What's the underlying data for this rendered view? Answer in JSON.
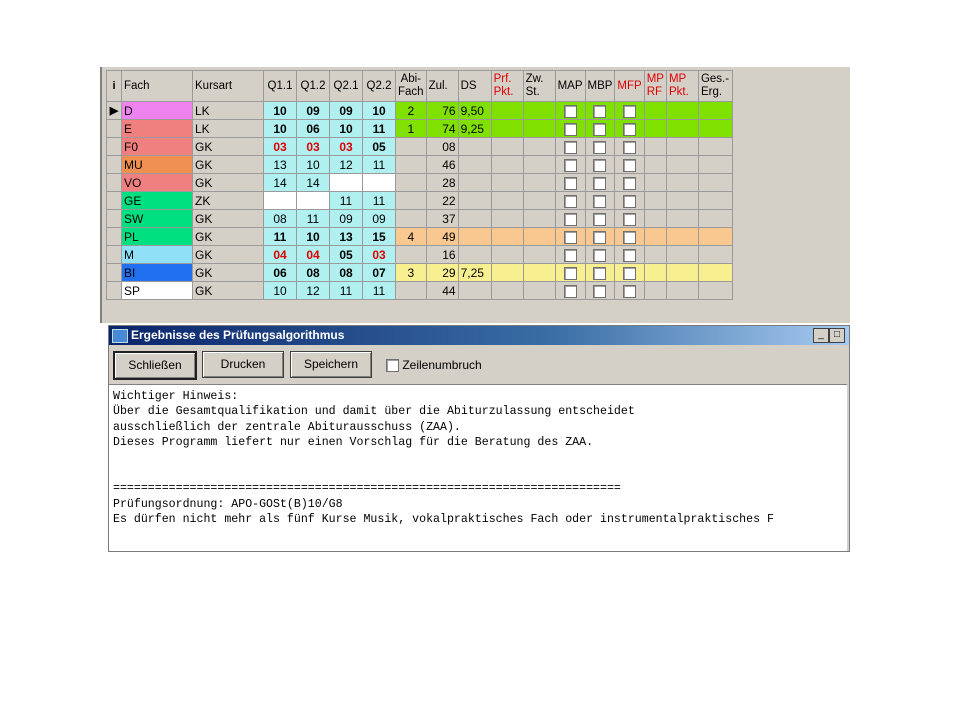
{
  "grid": {
    "headers": {
      "i": "i",
      "fach": "Fach",
      "kursart": "Kursart",
      "q11": "Q1.1",
      "q12": "Q1.2",
      "q21": "Q2.1",
      "q22": "Q2.2",
      "abi_1": "Abi-",
      "abi_2": "Fach",
      "zul": "Zul.",
      "ds": "DS",
      "prf_1": "Prf.",
      "prf_2": "Pkt.",
      "zw_1": "Zw.",
      "zw_2": "St.",
      "map": "MAP",
      "mbp": "MBP",
      "mfp": "MFP",
      "mprf_1": "MP",
      "mprf_2": "RF",
      "mppkt_1": "MP",
      "mppkt_2": "Pkt.",
      "ges_1": "Ges.-",
      "ges_2": "Erg."
    },
    "rows": [
      {
        "fach": "D",
        "kurs": "LK",
        "q": [
          "10",
          "09",
          "09",
          "10"
        ],
        "abi": "2",
        "zul": "76",
        "ds": "9,50",
        "fach_color": "#ee82ee",
        "row_color": "#80e000",
        "qbg": "#b0f0f0"
      },
      {
        "fach": "E",
        "kurs": "LK",
        "q": [
          "10",
          "06",
          "10",
          "11"
        ],
        "abi": "1",
        "zul": "74",
        "ds": "9,25",
        "fach_color": "#f08080",
        "row_color": "#80e000",
        "qbg": "#b0f0f0"
      },
      {
        "fach": "F0",
        "kurs": "GK",
        "q": [
          "03",
          "03",
          "03",
          "05"
        ],
        "abi": "",
        "zul": "08",
        "ds": "",
        "fach_color": "#f08080",
        "row_color": "",
        "qbg": "#b0f0f0"
      },
      {
        "fach": "MU",
        "kurs": "GK",
        "q": [
          "13",
          "10",
          "12",
          "11"
        ],
        "abi": "",
        "zul": "46",
        "ds": "",
        "fach_color": "#f09050",
        "row_color": "",
        "qbg": "#b0f0f0"
      },
      {
        "fach": "VO",
        "kurs": "GK",
        "q": [
          "14",
          "14",
          "",
          ""
        ],
        "abi": "",
        "zul": "28",
        "ds": "",
        "fach_color": "#f08080",
        "row_color": "",
        "qbg": "#b0f0f0"
      },
      {
        "fach": "GE",
        "kurs": "ZK",
        "q": [
          "",
          "",
          "11",
          "11"
        ],
        "abi": "",
        "zul": "22",
        "ds": "",
        "fach_color": "#00e080",
        "row_color": "",
        "qbg": "#b0f0f0"
      },
      {
        "fach": "SW",
        "kurs": "GK",
        "q": [
          "08",
          "11",
          "09",
          "09"
        ],
        "abi": "",
        "zul": "37",
        "ds": "",
        "fach_color": "#00e080",
        "row_color": "",
        "qbg": "#b0f0f0"
      },
      {
        "fach": "PL",
        "kurs": "GK",
        "q": [
          "11",
          "10",
          "13",
          "15"
        ],
        "abi": "4",
        "zul": "49",
        "ds": "",
        "fach_color": "#00e080",
        "row_color": "#f8c890",
        "qbg": "#b0f0f0"
      },
      {
        "fach": "M",
        "kurs": "GK",
        "q": [
          "04",
          "04",
          "05",
          "03"
        ],
        "abi": "",
        "zul": "16",
        "ds": "",
        "fach_color": "#90e0f8",
        "row_color": "",
        "qbg": "#b0f0f0"
      },
      {
        "fach": "BI",
        "kurs": "GK",
        "q": [
          "06",
          "08",
          "08",
          "07"
        ],
        "abi": "3",
        "zul": "29",
        "ds": "7,25",
        "fach_color": "#2070f0",
        "row_color": "#f8f090",
        "qbg": "#b0f0f0"
      },
      {
        "fach": "SP",
        "kurs": "GK",
        "q": [
          "10",
          "12",
          "11",
          "11"
        ],
        "abi": "",
        "zul": "44",
        "ds": "",
        "fach_color": "#ffffff",
        "row_color": "",
        "qbg": "#b0f0f0"
      }
    ],
    "bold_rows": [
      0,
      1,
      2,
      7,
      8,
      9
    ],
    "red_cells": [
      [
        2,
        0
      ],
      [
        2,
        1
      ],
      [
        2,
        2
      ],
      [
        8,
        0
      ],
      [
        8,
        1
      ],
      [
        8,
        3
      ]
    ],
    "current_row_marker": "▶"
  },
  "window": {
    "title": "Ergebnisse des Prüfungsalgorithmus",
    "minimize": "_",
    "maximize": "□",
    "buttons": {
      "close": "Schließen",
      "print": "Drucken",
      "save": "Speichern"
    },
    "checkbox_label": "Zeilenumbruch",
    "text": "Wichtiger Hinweis:\nÜber die Gesamtqualifikation und damit über die Abiturzulassung entscheidet\nausschließlich der zentrale Abiturausschuss (ZAA).\nDieses Programm liefert nur einen Vorschlag für die Beratung des ZAA.\n\n\n=========================================================================\nPrüfungsordnung: APO-GOSt(B)10/G8\nEs dürfen nicht mehr als fünf Kurse Musik, vokalpraktisches Fach oder instrumentalpraktisches F"
  }
}
